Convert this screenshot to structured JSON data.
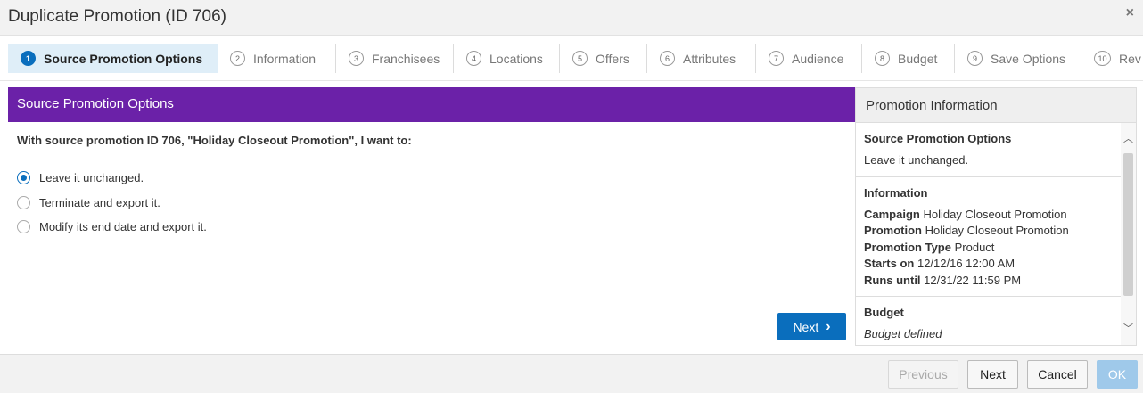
{
  "dialog": {
    "title": "Duplicate Promotion (ID 706)",
    "close_glyph": "×"
  },
  "steps": [
    {
      "num": "1",
      "label": "Source Promotion Options",
      "active": true
    },
    {
      "num": "2",
      "label": "Information"
    },
    {
      "num": "3",
      "label": "Franchisees"
    },
    {
      "num": "4",
      "label": "Locations"
    },
    {
      "num": "5",
      "label": "Offers"
    },
    {
      "num": "6",
      "label": "Attributes"
    },
    {
      "num": "7",
      "label": "Audience"
    },
    {
      "num": "8",
      "label": "Budget"
    },
    {
      "num": "9",
      "label": "Save Options"
    },
    {
      "num": "10",
      "label": "Rev"
    }
  ],
  "main": {
    "header": "Source Promotion Options",
    "question": "With source promotion ID 706, \"Holiday Closeout Promotion\", I want to:",
    "options": [
      {
        "label": "Leave it unchanged.",
        "checked": true
      },
      {
        "label": "Terminate and export it.",
        "checked": false
      },
      {
        "label": "Modify its end date and export it.",
        "checked": false
      }
    ],
    "next_label": "Next",
    "next_glyph": "›"
  },
  "info_panel": {
    "header": "Promotion Information",
    "source_section": {
      "title": "Source Promotion Options",
      "value": "Leave it unchanged."
    },
    "information_section": {
      "title": "Information",
      "rows": [
        {
          "label": "Campaign",
          "value": "Holiday Closeout Promotion"
        },
        {
          "label": "Promotion",
          "value": "Holiday Closeout Promotion"
        },
        {
          "label": "Promotion Type",
          "value": "Product"
        },
        {
          "label": "Starts on",
          "value": "12/12/16 12:00 AM"
        },
        {
          "label": "Runs until",
          "value": "12/31/22 11:59 PM"
        }
      ]
    },
    "budget_section": {
      "title": "Budget",
      "value": "Budget defined"
    },
    "scroll_up_glyph": "︿",
    "scroll_down_glyph": "﹀"
  },
  "footer": {
    "previous_label": "Previous",
    "next_label": "Next",
    "cancel_label": "Cancel",
    "ok_label": "OK"
  }
}
